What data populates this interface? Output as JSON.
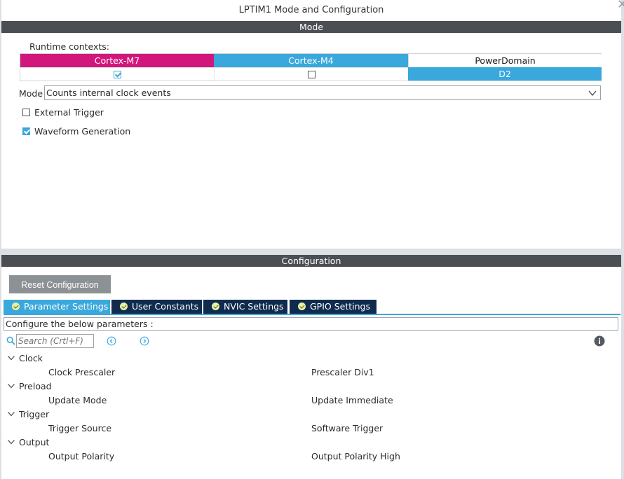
{
  "window": {
    "title": "LPTIM1 Mode and Configuration"
  },
  "mode_section": {
    "header": "Mode",
    "runtime_label": "Runtime contexts:",
    "contexts": [
      {
        "name": "Cortex-M7",
        "state": "checked",
        "color": "#d2177c"
      },
      {
        "name": "Cortex-M4",
        "state": "unchecked",
        "color": "#3aa8dc"
      },
      {
        "name": "PowerDomain",
        "state": "D2",
        "color": "#3aa8dc"
      }
    ],
    "mode_label": "Mode",
    "mode_value": "Counts internal clock events",
    "options": [
      {
        "label": "External Trigger",
        "checked": false
      },
      {
        "label": "Waveform Generation",
        "checked": true
      }
    ]
  },
  "config_section": {
    "header": "Configuration",
    "reset_label": "Reset Configuration",
    "tabs": [
      {
        "label": "Parameter Settings",
        "active": true
      },
      {
        "label": "User Constants",
        "active": false
      },
      {
        "label": "NVIC Settings",
        "active": false
      },
      {
        "label": "GPIO Settings",
        "active": false
      }
    ],
    "hint": "Configure the below parameters :",
    "search_placeholder": "Search (Crtl+F)",
    "groups": [
      {
        "name": "Clock",
        "params": [
          {
            "name": "Clock Prescaler",
            "value": "Prescaler Div1"
          }
        ]
      },
      {
        "name": "Preload",
        "params": [
          {
            "name": "Update Mode",
            "value": "Update Immediate"
          }
        ]
      },
      {
        "name": "Trigger",
        "params": [
          {
            "name": "Trigger Source",
            "value": "Software Trigger"
          }
        ]
      },
      {
        "name": "Output",
        "params": [
          {
            "name": "Output Polarity",
            "value": "Output Polarity High"
          }
        ]
      }
    ]
  },
  "colors": {
    "accent": "#3aa8dc",
    "m7": "#d2177c",
    "header_bar": "#4b4f54",
    "tab_dark": "#0f2c4e"
  }
}
